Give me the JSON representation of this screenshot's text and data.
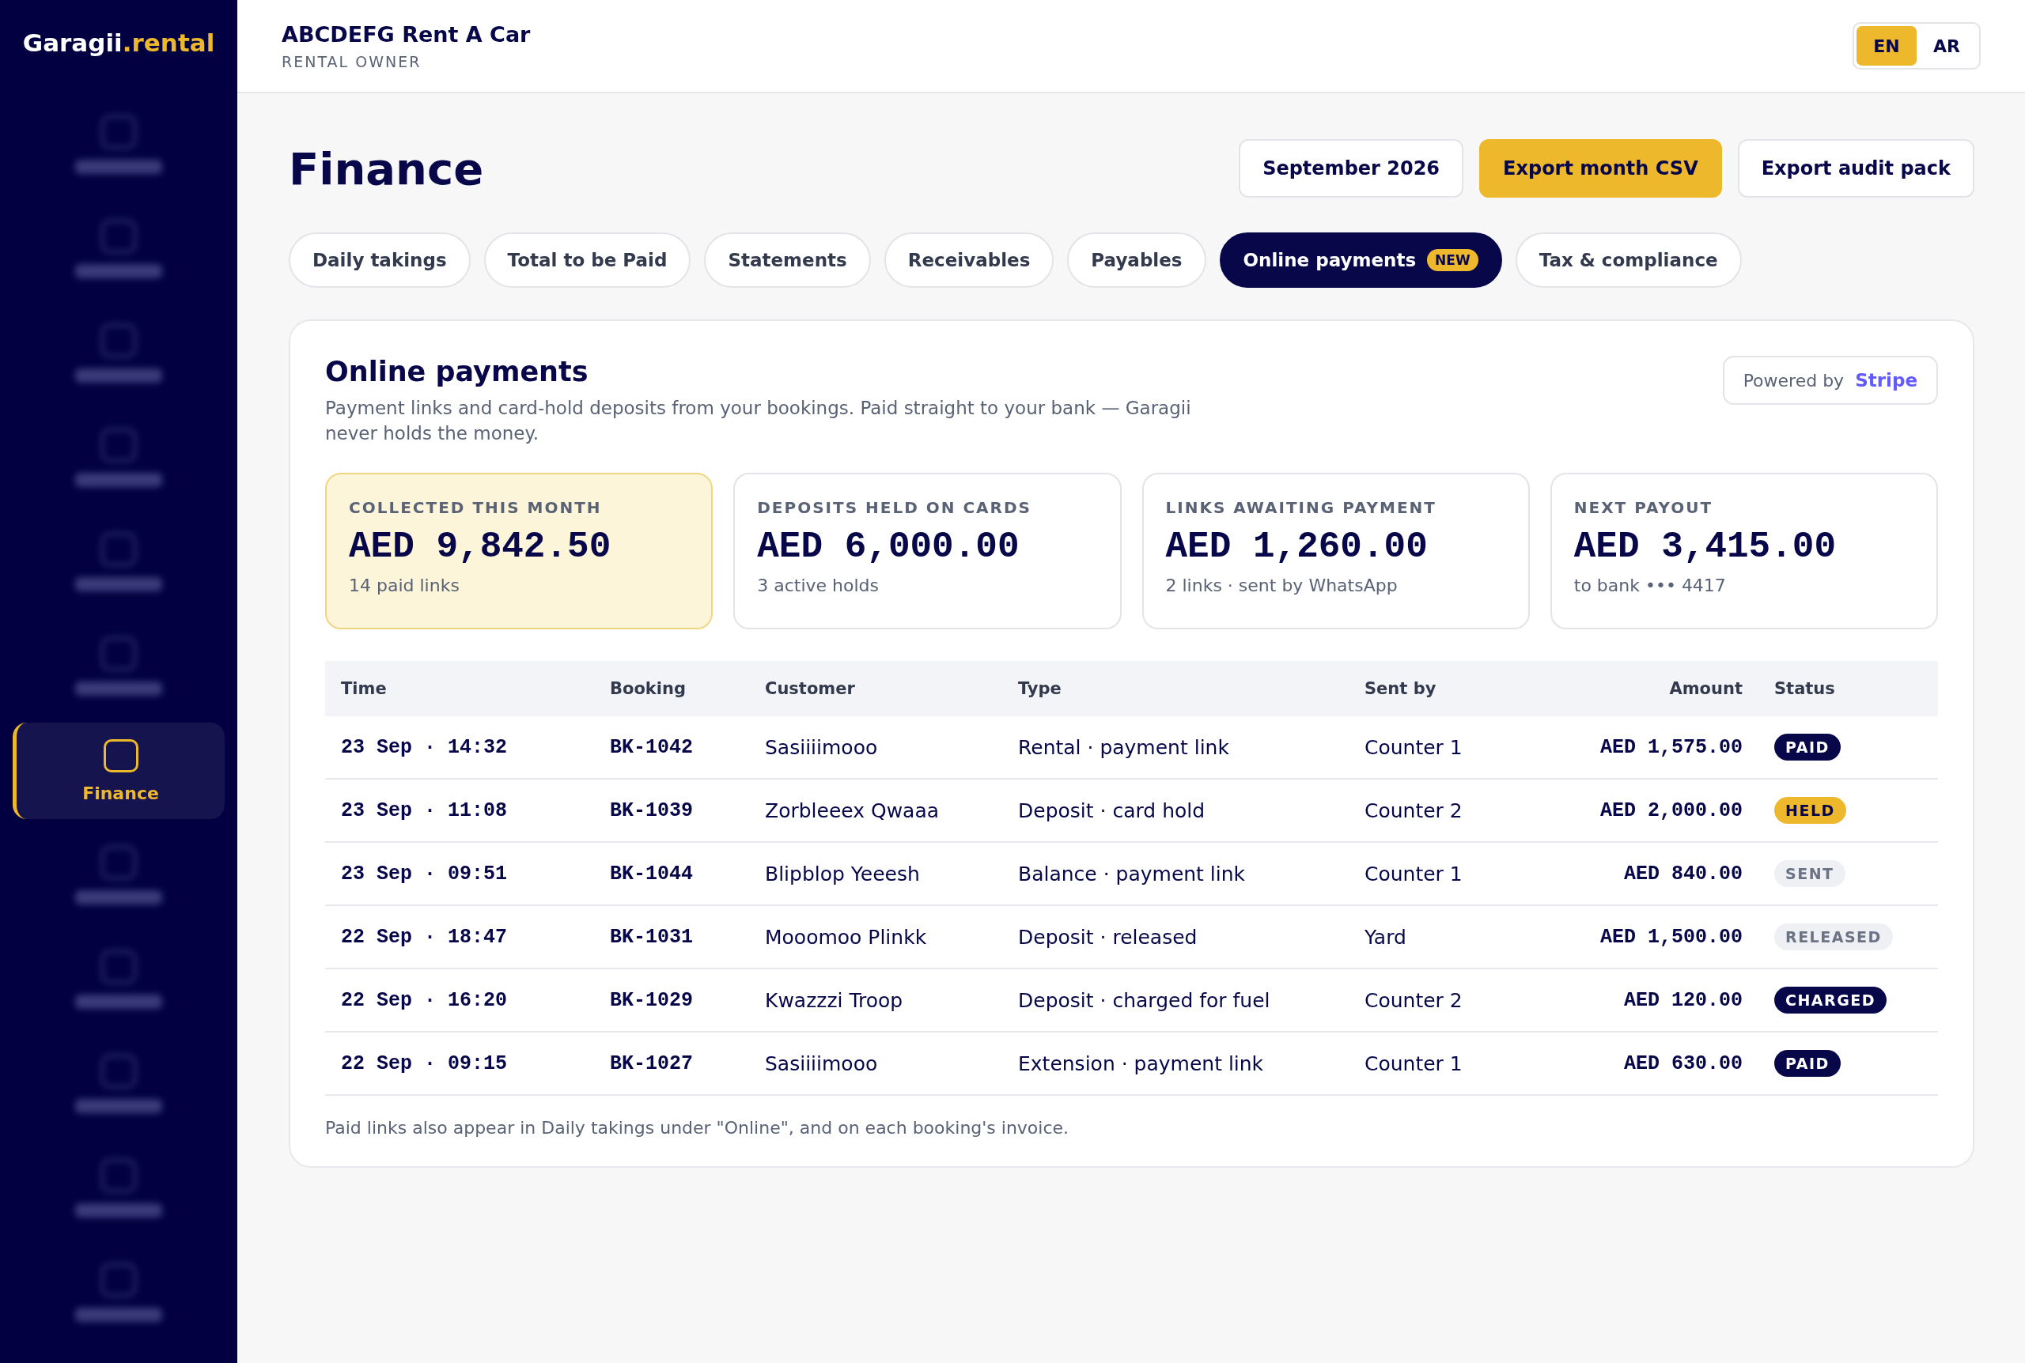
{
  "brand": {
    "name": "Garagii",
    "suffix": ".rental"
  },
  "sidebar": {
    "items": [
      {
        "kind": "blurred",
        "selected": false
      },
      {
        "kind": "blurred",
        "selected": false
      },
      {
        "kind": "blurred",
        "selected": false
      },
      {
        "kind": "blurred",
        "selected": false
      },
      {
        "kind": "blurred",
        "selected": false
      },
      {
        "kind": "blurred",
        "selected": false
      },
      {
        "kind": "label",
        "label": "Finance",
        "selected": true
      },
      {
        "kind": "blurred",
        "selected": false
      },
      {
        "kind": "blurred",
        "selected": false
      },
      {
        "kind": "blurred",
        "selected": false
      },
      {
        "kind": "blurred",
        "selected": false
      },
      {
        "kind": "blurred",
        "selected": false
      }
    ]
  },
  "header": {
    "company": "ABCDEFG Rent A Car",
    "role": "RENTAL OWNER",
    "languages": [
      {
        "label": "EN",
        "selected": true
      },
      {
        "label": "AR",
        "selected": false
      }
    ]
  },
  "page": {
    "title": "Finance",
    "actions": [
      {
        "label": "September 2026",
        "primary": false
      },
      {
        "label": "Export month CSV",
        "primary": true
      },
      {
        "label": "Export audit pack",
        "primary": false
      }
    ]
  },
  "tabs": [
    {
      "label": "Daily takings",
      "selected": false
    },
    {
      "label": "Total to be Paid",
      "selected": false
    },
    {
      "label": "Statements",
      "selected": false
    },
    {
      "label": "Receivables",
      "selected": false
    },
    {
      "label": "Payables",
      "selected": false
    },
    {
      "label": "Online payments",
      "badge": "NEW",
      "selected": true
    },
    {
      "label": "Tax & compliance",
      "selected": false
    }
  ],
  "panel": {
    "title": "Online payments",
    "description": "Payment links and card-hold deposits from your bookings. Paid straight to your bank — Garagii never holds the money.",
    "powered_by": {
      "label": "Powered by",
      "provider": "Stripe"
    },
    "stats": [
      {
        "label": "COLLECTED THIS MONTH",
        "value": "AED 9,842.50",
        "note": "14 paid links",
        "highlighted": true
      },
      {
        "label": "DEPOSITS HELD ON CARDS",
        "value": "AED 6,000.00",
        "note": "3 active holds",
        "highlighted": false
      },
      {
        "label": "LINKS AWAITING PAYMENT",
        "value": "AED 1,260.00",
        "note": "2 links · sent by WhatsApp",
        "highlighted": false
      },
      {
        "label": "NEXT PAYOUT",
        "value": "AED 3,415.00",
        "note": "to bank ••• 4417",
        "highlighted": false
      }
    ],
    "table": {
      "columns": [
        "Time",
        "Booking",
        "Customer",
        "Type",
        "Sent by",
        "Amount",
        "Status"
      ],
      "rows": [
        {
          "time": "23 Sep · 14:32",
          "booking": "BK-1042",
          "customer": "Sasiiiimooo",
          "type": "Rental · payment link",
          "sent_by": "Counter 1",
          "amount": "AED 1,575.00",
          "status": "PAID",
          "kind": "dark"
        },
        {
          "time": "23 Sep · 11:08",
          "booking": "BK-1039",
          "customer": "Zorbleeex Qwaaa",
          "type": "Deposit · card hold",
          "sent_by": "Counter 2",
          "amount": "AED 2,000.00",
          "status": "HELD",
          "kind": "yellow"
        },
        {
          "time": "23 Sep · 09:51",
          "booking": "BK-1044",
          "customer": "Blipblop Yeeesh",
          "type": "Balance · payment link",
          "sent_by": "Counter 1",
          "amount": "AED 840.00",
          "status": "SENT",
          "kind": "muted"
        },
        {
          "time": "22 Sep · 18:47",
          "booking": "BK-1031",
          "customer": "Mooomoo Plinkk",
          "type": "Deposit · released",
          "sent_by": "Yard",
          "amount": "AED 1,500.00",
          "status": "RELEASED",
          "kind": "muted"
        },
        {
          "time": "22 Sep · 16:20",
          "booking": "BK-1029",
          "customer": "Kwazzzi Troop",
          "type": "Deposit · charged for fuel",
          "sent_by": "Counter 2",
          "amount": "AED 120.00",
          "status": "CHARGED",
          "kind": "dark"
        },
        {
          "time": "22 Sep · 09:15",
          "booking": "BK-1027",
          "customer": "Sasiiiimooo",
          "type": "Extension · payment link",
          "sent_by": "Counter 1",
          "amount": "AED 630.00",
          "status": "PAID",
          "kind": "dark"
        }
      ]
    },
    "footnote": "Paid links also appear in Daily takings under \"Online\", and on each booking's invoice."
  }
}
